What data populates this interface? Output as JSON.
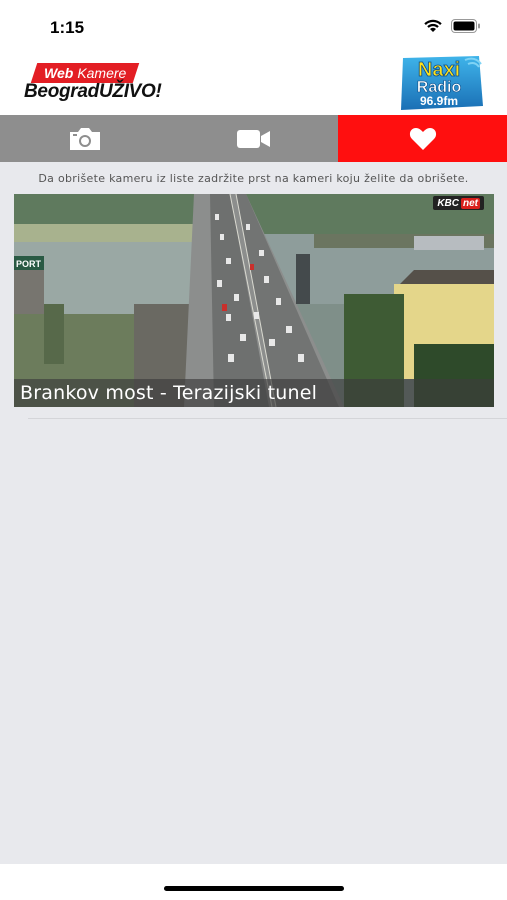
{
  "status_bar": {
    "time": "1:15",
    "icons": [
      "wifi-icon",
      "battery-icon"
    ]
  },
  "header": {
    "logo_tag_web": "Web",
    "logo_tag_kamere": "Kamere",
    "logo_main": "BeogradUŽIVO!",
    "radio_logo": {
      "line1": "Naxi",
      "line2": "Radio",
      "line3": "96.9fm"
    }
  },
  "tabs": [
    {
      "icon": "camera-icon",
      "active": false
    },
    {
      "icon": "video-camera-icon",
      "active": false
    },
    {
      "icon": "heart-icon",
      "active": true
    }
  ],
  "hint_text": "Da obrišete kameru iz liste zadržite prst na kameri koju želite da obrišete.",
  "cameras": [
    {
      "title": "Brankov most - Terazijski tunel",
      "badge_kbc": "KBC",
      "badge_net": "net",
      "watermark": "PORT"
    }
  ],
  "colors": {
    "tab_bar": "#8e8e8e",
    "tab_active": "#ff0f0f",
    "brand_red": "#e31e24",
    "background": "#e8e9ed"
  }
}
